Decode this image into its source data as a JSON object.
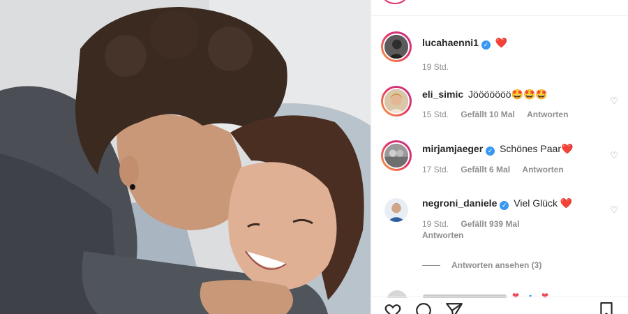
{
  "comments": [
    {
      "username": "lucahaenni1",
      "verified": true,
      "text": "",
      "emoji": "❤️",
      "time": "19 Std.",
      "likes": "",
      "reply": ""
    },
    {
      "username": "eli_simic",
      "verified": false,
      "text": "Jööööööö🤩🤩🤩",
      "time": "15 Std.",
      "likes": "Gefällt 10 Mal",
      "reply": "Antworten"
    },
    {
      "username": "mirjamjaeger",
      "verified": true,
      "text": "Schönes Paar❤️",
      "time": "17 Std.",
      "likes": "Gefällt 6 Mal",
      "reply": "Antworten"
    },
    {
      "username": "negroni_daniele",
      "verified": true,
      "text": "Viel Glück ❤️",
      "time": "19 Std.",
      "likes": "Gefällt 939 Mal",
      "reply": "Antworten"
    }
  ],
  "view_replies": "Antworten ansehen (3)",
  "icons": {
    "like": "heart-icon",
    "comment": "comment-icon",
    "share": "share-icon",
    "save": "bookmark-icon",
    "comment_like": "heart-outline-icon"
  },
  "colors": {
    "story_ring_start": "#f9a33a",
    "story_ring_end": "#c13584",
    "verified": "#3897f0",
    "secondary_text": "#8e8e8e",
    "primary_text": "#262626"
  }
}
